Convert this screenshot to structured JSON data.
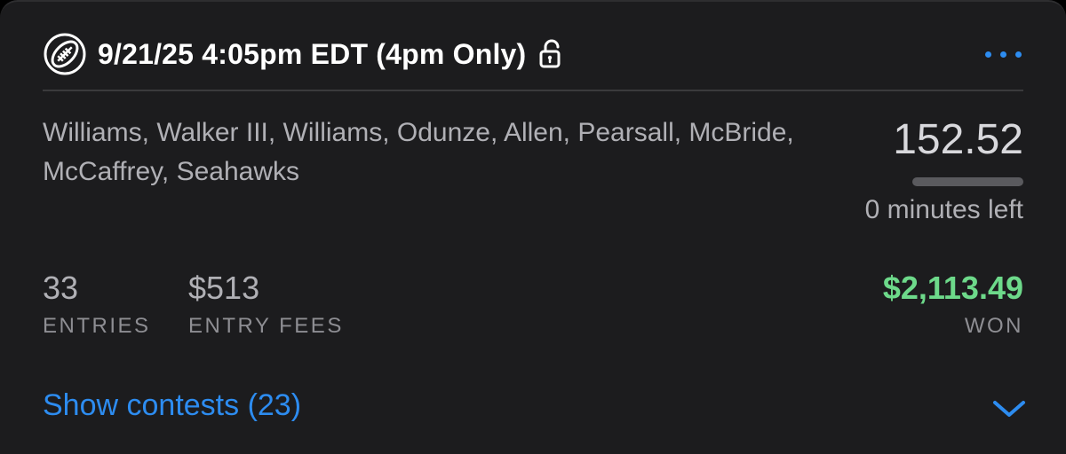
{
  "header": {
    "icon": "football-icon",
    "title": "9/21/25 4:05pm EDT (4pm Only)",
    "lock_icon": "unlocked-lock-icon",
    "more_icon": "more-horizontal-icon"
  },
  "lineup": {
    "players": "Williams, Walker III, Williams, Odunze, Allen, Pearsall, McBride, McCaffrey, Seahawks",
    "score": "152.52",
    "progress_fraction": 1.0,
    "time_left": "0 minutes left"
  },
  "stats": {
    "entries_value": "33",
    "entries_label": "ENTRIES",
    "fees_value": "$513",
    "fees_label": "ENTRY FEES",
    "won_value": "$2,113.49",
    "won_label": "WON"
  },
  "footer": {
    "show_contests": "Show contests (23)",
    "chevron_icon": "chevron-down-icon"
  },
  "colors": {
    "background": "#1c1c1e",
    "accent_blue": "#2d8cf0",
    "won_green": "#6dd98a",
    "text_primary": "#ffffff",
    "text_secondary": "#b0b0b5"
  }
}
